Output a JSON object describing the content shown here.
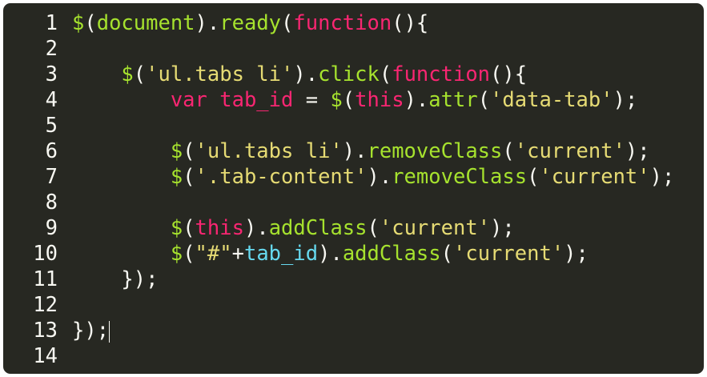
{
  "colors": {
    "background": "#272822",
    "plain": "#f8f8f2",
    "function_call": "#a6e22e",
    "keyword": "#f92672",
    "string": "#e6db74",
    "variable": "#66d9ef"
  },
  "editor": {
    "lines": [
      {
        "number": "1",
        "tokens": [
          {
            "text": "$",
            "type": "function_call"
          },
          {
            "text": "(",
            "type": "plain"
          },
          {
            "text": "document",
            "type": "function_call"
          },
          {
            "text": ").",
            "type": "plain"
          },
          {
            "text": "ready",
            "type": "function_call"
          },
          {
            "text": "(",
            "type": "plain"
          },
          {
            "text": "function",
            "type": "keyword"
          },
          {
            "text": "(){",
            "type": "plain"
          }
        ]
      },
      {
        "number": "2",
        "tokens": []
      },
      {
        "number": "3",
        "tokens": [
          {
            "text": "    ",
            "type": "plain"
          },
          {
            "text": "$",
            "type": "function_call"
          },
          {
            "text": "(",
            "type": "plain"
          },
          {
            "text": "'ul.tabs li'",
            "type": "string"
          },
          {
            "text": ").",
            "type": "plain"
          },
          {
            "text": "click",
            "type": "function_call"
          },
          {
            "text": "(",
            "type": "plain"
          },
          {
            "text": "function",
            "type": "keyword"
          },
          {
            "text": "(){",
            "type": "plain"
          }
        ]
      },
      {
        "number": "4",
        "tokens": [
          {
            "text": "        ",
            "type": "plain"
          },
          {
            "text": "var",
            "type": "keyword"
          },
          {
            "text": " ",
            "type": "plain"
          },
          {
            "text": "tab_id",
            "type": "keyword"
          },
          {
            "text": " = ",
            "type": "plain"
          },
          {
            "text": "$",
            "type": "function_call"
          },
          {
            "text": "(",
            "type": "plain"
          },
          {
            "text": "this",
            "type": "keyword"
          },
          {
            "text": ").",
            "type": "plain"
          },
          {
            "text": "attr",
            "type": "function_call"
          },
          {
            "text": "(",
            "type": "plain"
          },
          {
            "text": "'data-tab'",
            "type": "string"
          },
          {
            "text": ");",
            "type": "plain"
          }
        ]
      },
      {
        "number": "5",
        "tokens": []
      },
      {
        "number": "6",
        "tokens": [
          {
            "text": "        ",
            "type": "plain"
          },
          {
            "text": "$",
            "type": "function_call"
          },
          {
            "text": "(",
            "type": "plain"
          },
          {
            "text": "'ul.tabs li'",
            "type": "string"
          },
          {
            "text": ").",
            "type": "plain"
          },
          {
            "text": "removeClass",
            "type": "function_call"
          },
          {
            "text": "(",
            "type": "plain"
          },
          {
            "text": "'current'",
            "type": "string"
          },
          {
            "text": ");",
            "type": "plain"
          }
        ]
      },
      {
        "number": "7",
        "tokens": [
          {
            "text": "        ",
            "type": "plain"
          },
          {
            "text": "$",
            "type": "function_call"
          },
          {
            "text": "(",
            "type": "plain"
          },
          {
            "text": "'.tab-content'",
            "type": "string"
          },
          {
            "text": ").",
            "type": "plain"
          },
          {
            "text": "removeClass",
            "type": "function_call"
          },
          {
            "text": "(",
            "type": "plain"
          },
          {
            "text": "'current'",
            "type": "string"
          },
          {
            "text": ");",
            "type": "plain"
          }
        ]
      },
      {
        "number": "8",
        "tokens": []
      },
      {
        "number": "9",
        "tokens": [
          {
            "text": "        ",
            "type": "plain"
          },
          {
            "text": "$",
            "type": "function_call"
          },
          {
            "text": "(",
            "type": "plain"
          },
          {
            "text": "this",
            "type": "keyword"
          },
          {
            "text": ").",
            "type": "plain"
          },
          {
            "text": "addClass",
            "type": "function_call"
          },
          {
            "text": "(",
            "type": "plain"
          },
          {
            "text": "'current'",
            "type": "string"
          },
          {
            "text": ");",
            "type": "plain"
          }
        ]
      },
      {
        "number": "10",
        "tokens": [
          {
            "text": "        ",
            "type": "plain"
          },
          {
            "text": "$",
            "type": "function_call"
          },
          {
            "text": "(",
            "type": "plain"
          },
          {
            "text": "\"#\"",
            "type": "string"
          },
          {
            "text": "+",
            "type": "plain"
          },
          {
            "text": "tab_id",
            "type": "variable"
          },
          {
            "text": ").",
            "type": "plain"
          },
          {
            "text": "addClass",
            "type": "function_call"
          },
          {
            "text": "(",
            "type": "plain"
          },
          {
            "text": "'current'",
            "type": "string"
          },
          {
            "text": ");",
            "type": "plain"
          }
        ]
      },
      {
        "number": "11",
        "tokens": [
          {
            "text": "    ",
            "type": "plain"
          },
          {
            "text": "});",
            "type": "plain"
          }
        ]
      },
      {
        "number": "12",
        "tokens": []
      },
      {
        "number": "13",
        "tokens": [
          {
            "text": "});",
            "type": "plain"
          }
        ],
        "cursor": true
      },
      {
        "number": "14",
        "tokens": []
      }
    ]
  }
}
